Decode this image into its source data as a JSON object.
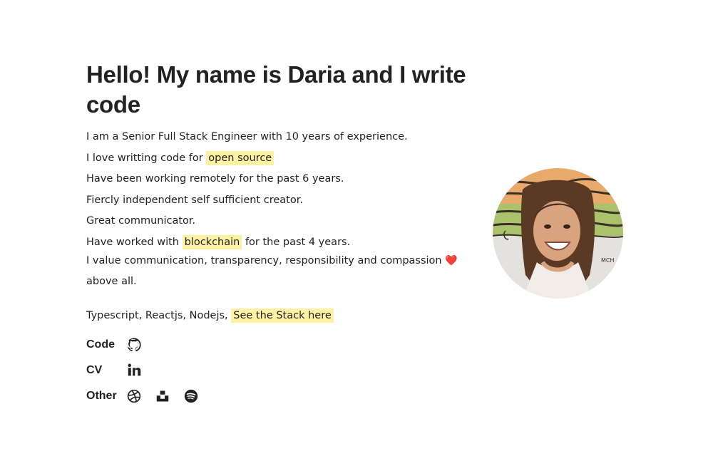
{
  "intro": {
    "title": "Hello! My name is Daria and I write code",
    "line1": "I am a Senior Full Stack Engineer with 10 years of experience.",
    "line2_prefix": "I love writting code for",
    "line2_link": "open source",
    "line3": "Have been working remotely for the past 6 years.",
    "line4": "Fiercly independent self sufficient creator.",
    "line5": "Great communicator.",
    "line6_prefix": "Have worked with",
    "line6_link": "blockchain",
    "line6_suffix": "for the past 4 years.",
    "line7_prefix": "I value communication, transparency, responsibility and compassion",
    "line7_emoji": "❤️",
    "line7_suffix": "above all.",
    "stack_prefix": "Typescript, Reactjs, Nodejs,",
    "stack_link": "See the Stack here"
  },
  "links": {
    "code_label": "Code",
    "cv_label": "CV",
    "other_label": "Other"
  },
  "icons": {
    "code": [
      "github-icon"
    ],
    "cv": [
      "linkedin-icon"
    ],
    "other": [
      "dribbble-icon",
      "unsplash-icon",
      "spotify-icon"
    ]
  },
  "colors": {
    "highlight": "#fdf1a3",
    "text": "#222222",
    "heart": "#e0313e"
  }
}
